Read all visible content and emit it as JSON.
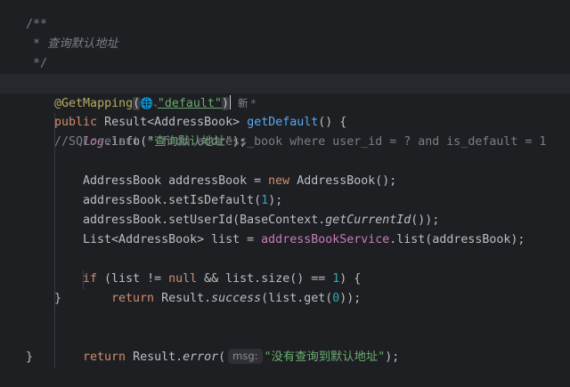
{
  "code": {
    "javadoc": {
      "open": "/**",
      "text": " * 查询默认地址",
      "close": " */"
    },
    "annotation": {
      "name": "@GetMapping",
      "open_paren": "(",
      "url_value": "\"default\"",
      "close_paren": ")",
      "globe_icon": "🌐",
      "chevron_icon": "⌄",
      "hint_label": "新",
      "hint_star": "*"
    },
    "method_decl": {
      "modifier": "public",
      "return_type": " Result<AddressBook> ",
      "name": "getDefault",
      "rest": "() {"
    },
    "log_line": {
      "field": "log",
      "call": ".info(",
      "arg": "\"查询默认地址\"",
      "end": ");"
    },
    "sql_comment": "//SQL:select * from address_book where user_id = ? and is_default = 1",
    "new_line": {
      "prefix": "AddressBook addressBook = ",
      "kw": "new",
      "suffix": " AddressBook();"
    },
    "set_default_line": {
      "prefix": "addressBook.setIsDefault(",
      "num": "1",
      "suffix": ");"
    },
    "set_user_line": {
      "prefix": "addressBook.setUserId(BaseContext.",
      "method": "getCurrentId",
      "suffix": "());"
    },
    "list_line": {
      "prefix": "List<AddressBook> list = ",
      "service": "addressBookService",
      "suffix": ".list(addressBook);"
    },
    "if_line": {
      "kw": "if",
      "part1": " (list != ",
      "null_kw": "null",
      "part2": " && list.size() == ",
      "num": "1",
      "part3": ") {"
    },
    "return_success_line": {
      "kw": "return",
      "prefix": " Result.",
      "method": "success",
      "mid": "(list.get(",
      "num": "0",
      "suffix": "));"
    },
    "close_if": "}",
    "return_error_line": {
      "kw": "return",
      "prefix": " Result.",
      "method": "error",
      "open": "(",
      "param_hint": "msg:",
      "arg": "\"没有查询到默认地址\"",
      "suffix": ");"
    },
    "close_method": "}"
  },
  "colors": {
    "background": "#1e1f22",
    "keyword": "#cf8e6d",
    "method_decl": "#56a8f5",
    "string": "#6aab73",
    "number": "#2aacb8",
    "comment": "#7a7e85",
    "annotation": "#b3ae60",
    "field": "#c77dbb"
  }
}
